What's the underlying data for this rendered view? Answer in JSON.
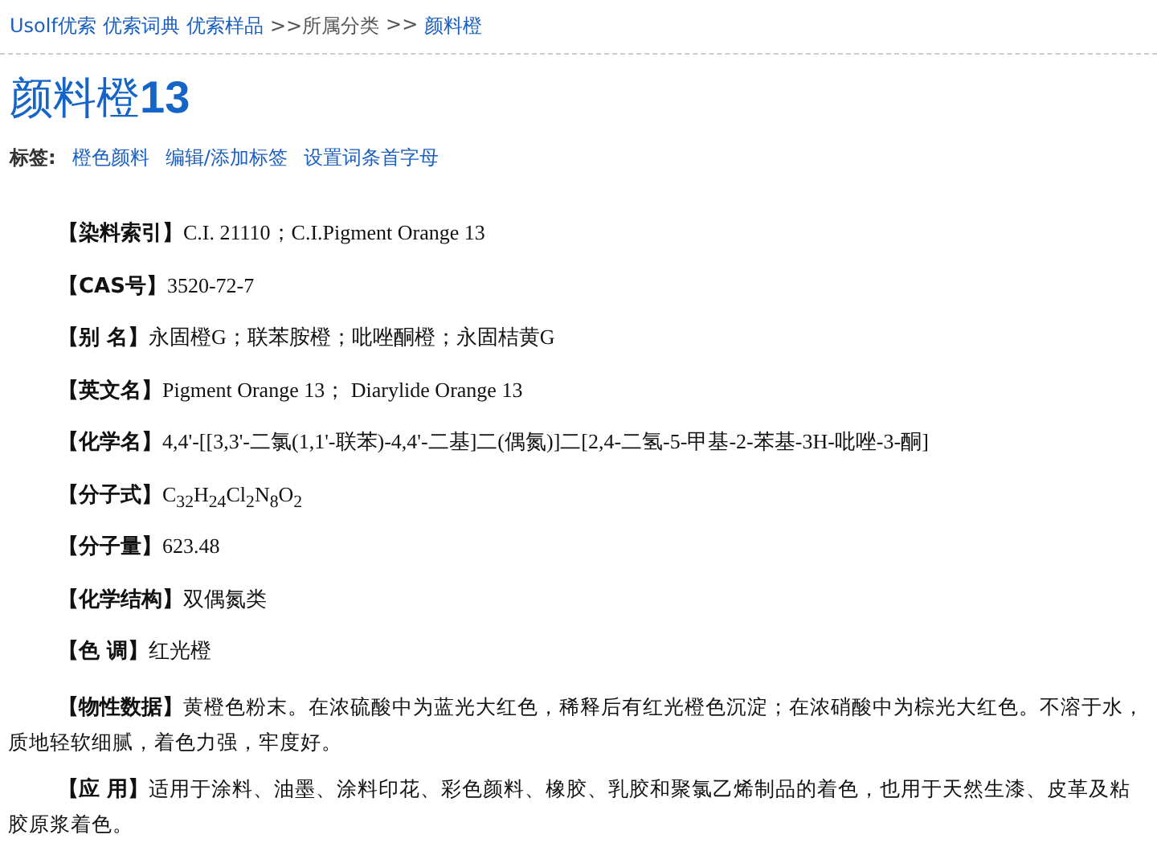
{
  "breadcrumb": [
    {
      "text": "Usolf优索",
      "kind": "link"
    },
    {
      "text": "优索词典",
      "kind": "link"
    },
    {
      "text": "优索样品",
      "kind": "link"
    },
    {
      "text": ">>所属分类",
      "kind": "plain"
    },
    {
      "text": ">>",
      "kind": "plain"
    },
    {
      "text": "颜料橙",
      "kind": "link"
    }
  ],
  "title": {
    "name": "颜料橙",
    "number": "13"
  },
  "tags": {
    "label": "标签:",
    "links": [
      "橙色颜料",
      "编辑/添加标签",
      "设置词条首字母"
    ]
  },
  "fields": [
    {
      "kind": "line",
      "label": "【染料索引】",
      "value": "C.I. 21110；C.I.Pigment Orange 13"
    },
    {
      "kind": "line",
      "label": "【CAS号】",
      "value": "3520-72-7"
    },
    {
      "kind": "line",
      "label": "【别 名】",
      "value": "永固橙G；联苯胺橙；吡唑酮橙；永固桔黄G"
    },
    {
      "kind": "line",
      "label": "【英文名】",
      "value": "Pigment Orange 13；  Diarylide Orange 13"
    },
    {
      "kind": "line",
      "label": "【化学名】",
      "value": "4,4'-[[3,3'-二氯(1,1'-联苯)-4,4'-二基]二(偶氮)]二[2,4-二氢-5-甲基-2-苯基-3H-吡唑-3-酮]"
    },
    {
      "kind": "line",
      "label": "【分子式】",
      "value": "C$_{32}$H$_{24}$Cl$_{2}$N$_{8}$O$_{2}$"
    },
    {
      "kind": "line",
      "label": "【分子量】",
      "value": "623.48"
    },
    {
      "kind": "line",
      "label": "【化学结构】",
      "value": "双偶氮类"
    },
    {
      "kind": "line",
      "label": "【色 调】",
      "value": "红光橙"
    },
    {
      "kind": "paragraph",
      "label": "【物性数据】",
      "value": "黄橙色粉末。在浓硫酸中为蓝光大红色，稀释后有红光橙色沉淀；在浓硝酸中为棕光大红色。不溶于水，质地轻软细腻，着色力强，牢度好。"
    },
    {
      "kind": "paragraph",
      "label": "【应 用】",
      "value": "适用于涂料、油墨、涂料印花、彩色颜料、橡胶、乳胶和聚氯乙烯制品的着色，也用于天然生漆、皮革及粘胶原浆着色。"
    }
  ]
}
